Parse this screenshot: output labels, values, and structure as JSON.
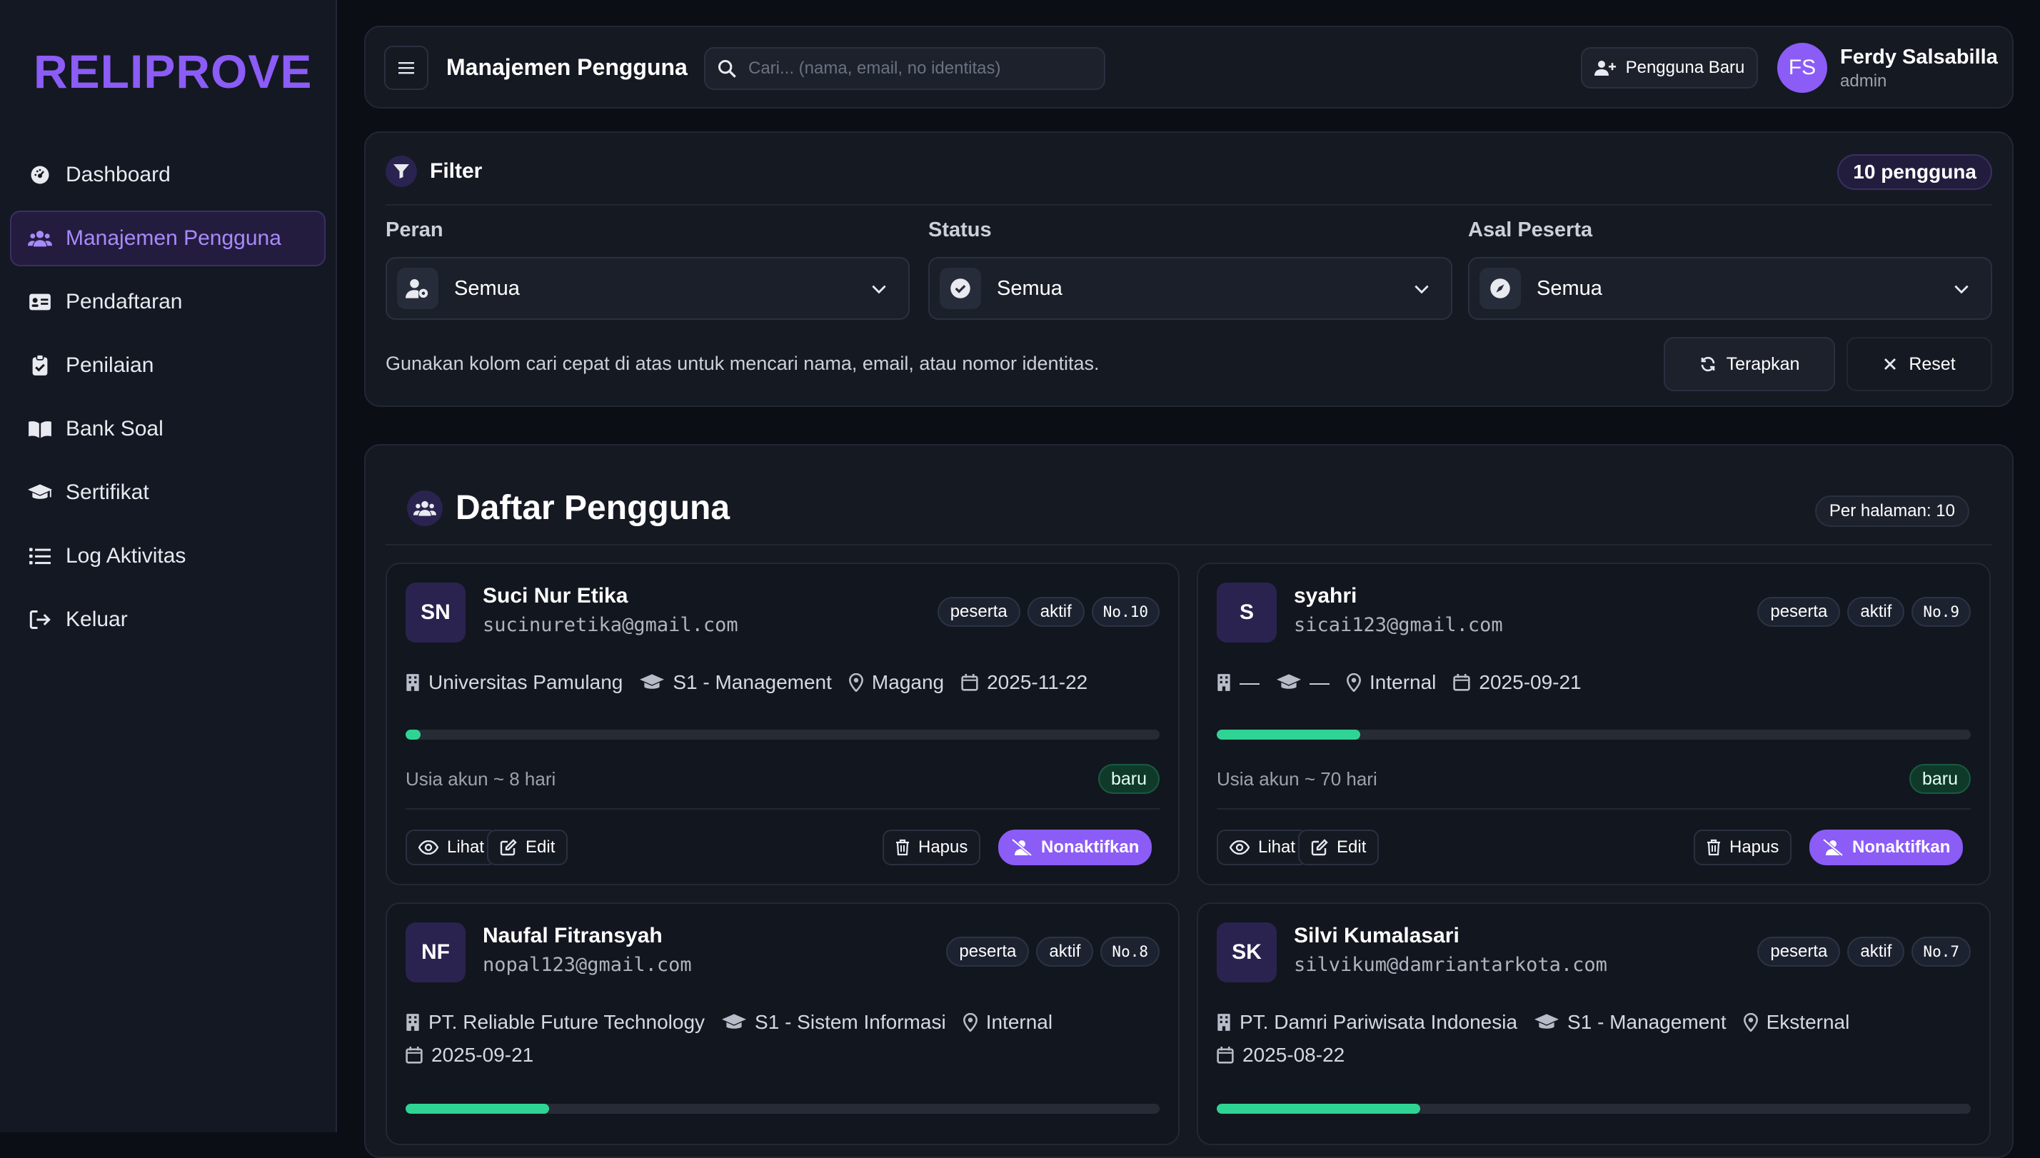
{
  "brand": "RELIPROVE",
  "sidebar": {
    "items": [
      {
        "label": "Dashboard",
        "icon": "dashboard-gauge-icon",
        "active": false
      },
      {
        "label": "Manajemen Pengguna",
        "icon": "users-icon",
        "active": true
      },
      {
        "label": "Pendaftaran",
        "icon": "id-card-icon",
        "active": false
      },
      {
        "label": "Penilaian",
        "icon": "clipboard-check-icon",
        "active": false
      },
      {
        "label": "Bank Soal",
        "icon": "book-open-icon",
        "active": false
      },
      {
        "label": "Sertifikat",
        "icon": "graduation-cap-icon",
        "active": false
      },
      {
        "label": "Log Aktivitas",
        "icon": "list-icon",
        "active": false
      },
      {
        "label": "Keluar",
        "icon": "logout-icon",
        "active": false
      }
    ]
  },
  "topbar": {
    "title": "Manajemen Pengguna",
    "search_placeholder": "Cari... (nama, email, no identitas)",
    "new_user_label": "Pengguna Baru",
    "user": {
      "initials": "FS",
      "name": "Ferdy Salsabilla",
      "role": "admin"
    }
  },
  "filter": {
    "title": "Filter",
    "count_label": "10 pengguna",
    "groups": [
      {
        "label": "Peran",
        "value": "Semua",
        "icon": "user-cog-icon"
      },
      {
        "label": "Status",
        "value": "Semua",
        "icon": "check-circle-icon"
      },
      {
        "label": "Asal Peserta",
        "value": "Semua",
        "icon": "compass-icon"
      }
    ],
    "hint": "Gunakan kolom cari cepat di atas untuk mencari nama, email, atau nomor identitas.",
    "apply_label": "Terapkan",
    "reset_label": "Reset"
  },
  "list": {
    "title": "Daftar Pengguna",
    "per_page": "Per halaman: 10",
    "actions": {
      "view": "Lihat",
      "edit": "Edit",
      "delete": "Hapus",
      "deactivate": "Nonaktifkan"
    },
    "users": [
      {
        "initials": "SN",
        "name": "Suci Nur Etika",
        "email": "sucinuretika@gmail.com",
        "role": "peserta",
        "status": "aktif",
        "no": "No.10",
        "institution": "Universitas Pamulang",
        "program": "S1 - Management",
        "origin": "Magang",
        "date": "2025-11-22",
        "age": "Usia akun ~ 8 hari",
        "badge": "baru",
        "progress": 0.02
      },
      {
        "initials": "S",
        "name": "syahri",
        "email": "sicai123@gmail.com",
        "role": "peserta",
        "status": "aktif",
        "no": "No.9",
        "institution": "—",
        "program": "—",
        "origin": "Internal",
        "date": "2025-09-21",
        "age": "Usia akun ~ 70 hari",
        "badge": "baru",
        "progress": 0.19
      },
      {
        "initials": "NF",
        "name": "Naufal Fitransyah",
        "email": "nopal123@gmail.com",
        "role": "peserta",
        "status": "aktif",
        "no": "No.8",
        "institution": "PT. Reliable Future Technology",
        "program": "S1 - Sistem Informasi",
        "origin": "Internal",
        "date": "2025-09-21",
        "progress": 0.19
      },
      {
        "initials": "SK",
        "name": "Silvi Kumalasari",
        "email": "silvikum@damriantarkota.com",
        "role": "peserta",
        "status": "aktif",
        "no": "No.7",
        "institution": "PT. Damri Pariwisata Indonesia",
        "program": "S1 - Management",
        "origin": "Eksternal",
        "date": "2025-08-22",
        "progress": 0.27
      }
    ]
  }
}
